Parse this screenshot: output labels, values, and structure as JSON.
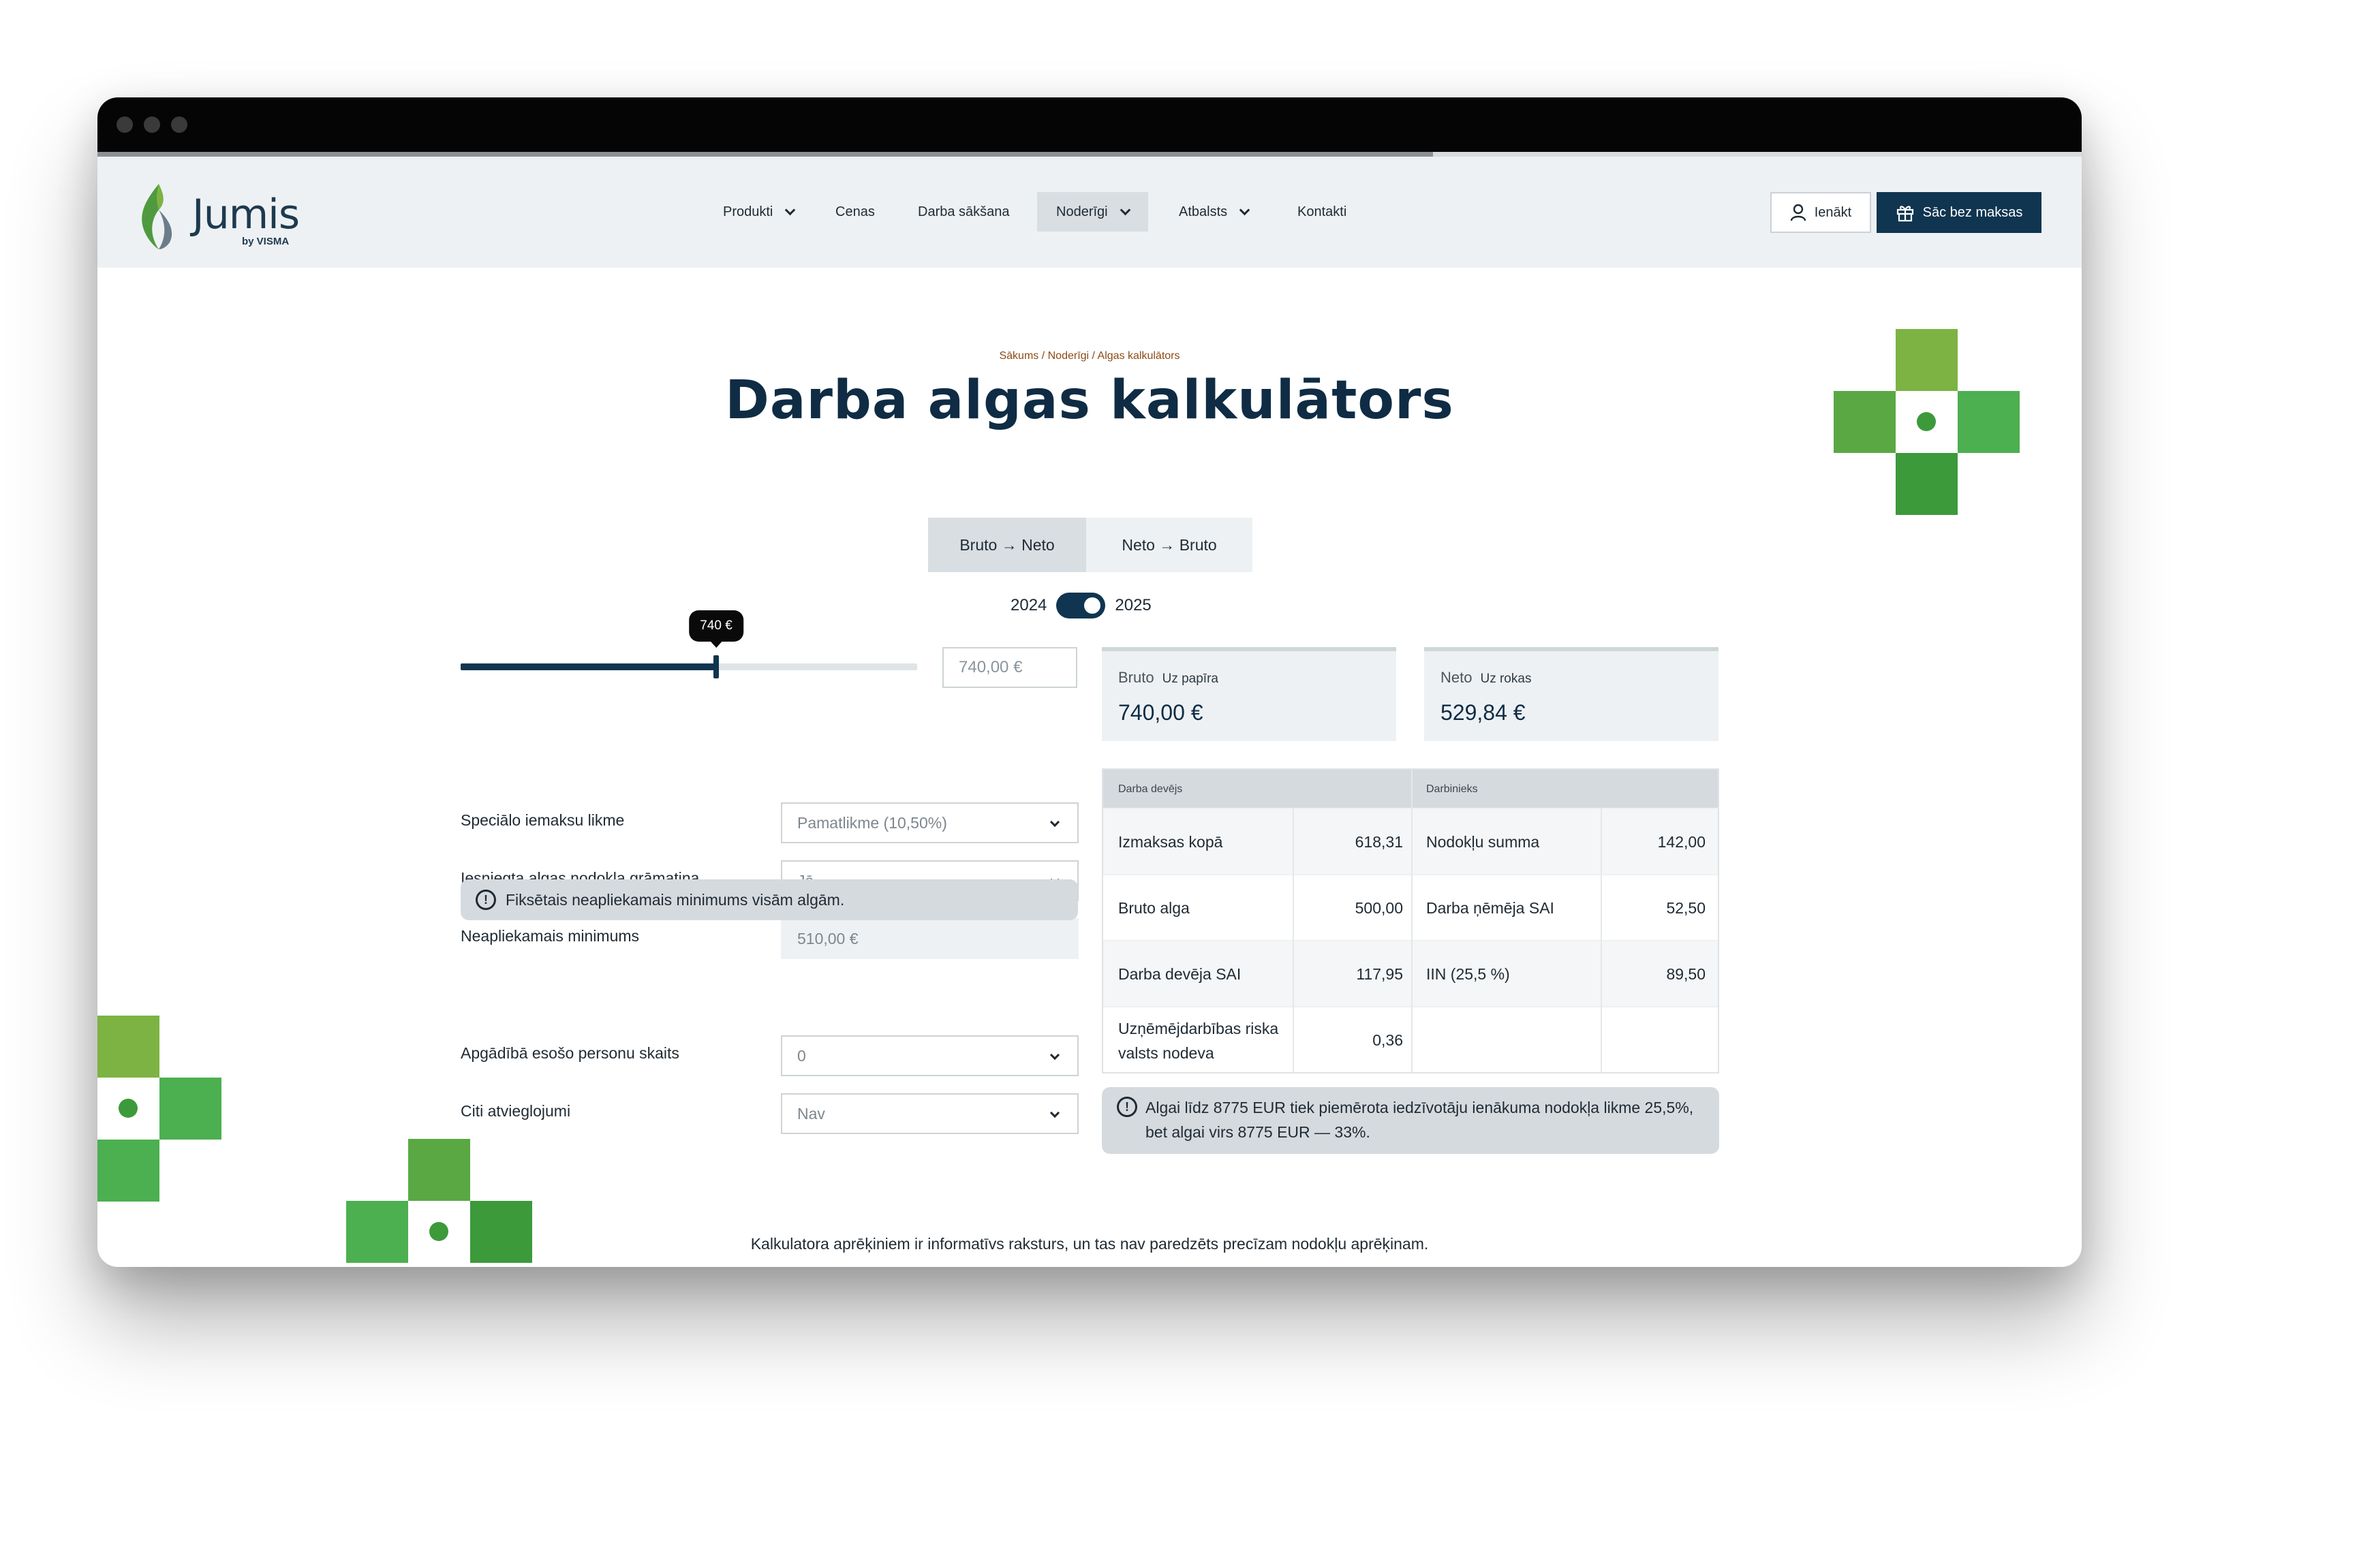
{
  "header": {
    "logo_text": "Jumis",
    "logo_sub": "by VISMA",
    "nav": [
      "Produkti",
      "Cenas",
      "Darba sākšana",
      "Noderīgi",
      "Atbalsts",
      "Kontakti"
    ],
    "login_label": "Ienākt",
    "start_label": "Sāc bez maksas"
  },
  "breadcrumb": "Sākums / Noderīgi / Algas kalkulātors",
  "title": "Darba algas kalkulātors",
  "mode_tabs": [
    "Bruto → Neto",
    "Neto → Bruto"
  ],
  "years": {
    "left": "2024",
    "right": "2025",
    "selected": "2025"
  },
  "slider": {
    "tooltip": "740 €",
    "value_fraction": 0.56,
    "input_value": "740,00 €"
  },
  "form": {
    "rows": [
      {
        "label": "Speciālo iemaksu likme",
        "value": "Pamatlikme (10,50%)"
      },
      {
        "label": "Iesniegta algas nodokļa grāmatiņa",
        "value": "Jā"
      },
      {
        "label": "Neapliekamais minimums",
        "value": "510,00 €"
      },
      {
        "label": "Apgādībā esošo personu skaits",
        "value": "0"
      },
      {
        "label": "Citi atvieglojumi",
        "value": "Nav"
      }
    ],
    "notice": "Fiksētais neapliekamais minimums visām algām."
  },
  "cards": {
    "bruto": {
      "label": "Bruto",
      "tag": "Uz papīra",
      "value": "740,00 €"
    },
    "neto": {
      "label": "Neto",
      "tag": "Uz rokas",
      "value": "529,84 €"
    }
  },
  "results": {
    "employer_head": "Darba devējs",
    "employee_head": "Darbinieks",
    "rows": [
      {
        "a_label": "Izmaksas kopā",
        "a_value": "618,31",
        "b_label": "Nodokļu summa",
        "b_value": "142,00"
      },
      {
        "a_label": "Bruto alga",
        "a_value": "500,00",
        "b_label": "Darba ņēmēja SAI",
        "b_value": "52,50"
      },
      {
        "a_label": "Darba devēja SAI",
        "a_value": "117,95",
        "b_label": "IIN (25,5 %)",
        "b_value": "89,50"
      },
      {
        "a_label": "Uzņēmējdarbības riska valsts nodeva",
        "a_value": "0,36",
        "b_label": "",
        "b_value": ""
      }
    ]
  },
  "tax_notice": "Algai līdz 8775 EUR tiek piemērota iedzīvotāju ienākuma nodokļa likme 25,5%, bet algai virs 8775 EUR — 33%.",
  "footnote": "Kalkulatora aprēķiniem ir informatīvs raksturs, un tas nav paredzēts precīzam nodokļu aprēķinam.",
  "colors": {
    "primary": "#0f3550",
    "green_light": "#7cb342",
    "green_mid": "#4caf50",
    "green_dark": "#3c9a3b",
    "breadcrumb": "#8c4a16"
  },
  "icons": [
    "user-icon",
    "gift-icon",
    "info-icon",
    "chevron-down-icon"
  ]
}
